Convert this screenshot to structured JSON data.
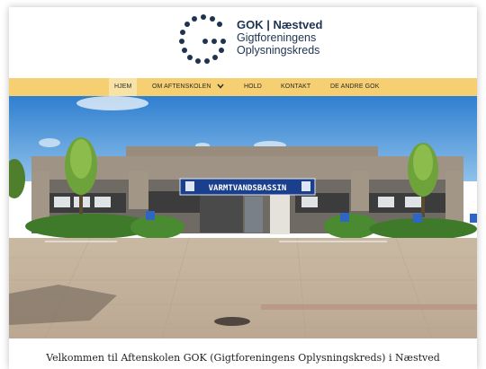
{
  "brand": {
    "name": "GOK | Næstved",
    "line1": "Gigtforeningens",
    "line2": "Oplysningskreds"
  },
  "nav": {
    "items": [
      {
        "label": "HJEM",
        "active": true
      },
      {
        "label": "OM AFTENSKOLEN",
        "dropdown": true
      },
      {
        "label": "HOLD"
      },
      {
        "label": "KONTAKT"
      },
      {
        "label": "DE ANDRE GOK"
      }
    ]
  },
  "hero": {
    "sign_text": "VARMTVANDSBASSIN"
  },
  "welcome_text": "Velkommen til Aftenskolen GOK (Gigtforeningens Oplysningskreds) i Næstved",
  "colors": {
    "nav_bg": "#f5cf71",
    "nav_active_bg": "#f7e3a6",
    "brand_dark": "#1d3350",
    "sky": "#3f8fd6"
  }
}
